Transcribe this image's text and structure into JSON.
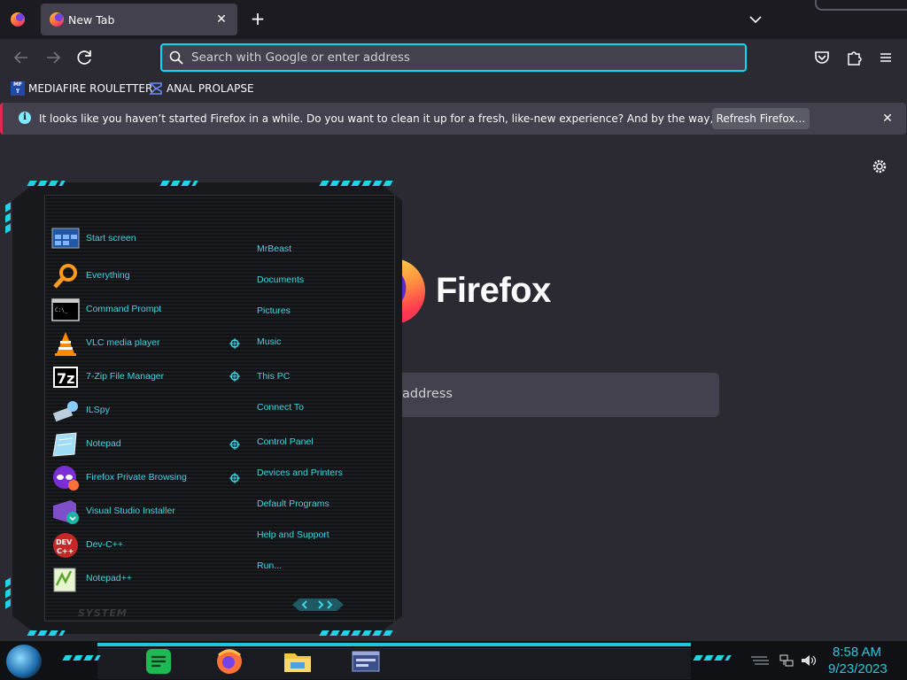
{
  "colors": {
    "accent": "#00ddff",
    "menu_text": "#3fd6e4",
    "clock": "#2ec6de",
    "notice_border": "#e22850"
  },
  "tabs": [
    {
      "title": "New Tab",
      "icon": "firefox-icon",
      "close_label": "✕"
    }
  ],
  "tabstrip": {
    "new_tab_label": "+"
  },
  "urlbar": {
    "placeholder": "Search with Google or enter address"
  },
  "bookmarks": [
    {
      "label": "MEDIAFIRE ROULETTER",
      "icon": "mediafire-icon",
      "icon_text": "MF T"
    },
    {
      "label": "ANAL PROLAPSE",
      "icon": "sigma-icon"
    }
  ],
  "notice": {
    "text": "It looks like you haven’t started Firefox in a while. Do you want to clean it up for a fresh, like-new experience? And by the way, welcome back!",
    "button": "Refresh Firefox…",
    "info_glyph": "i",
    "close_glyph": "✕"
  },
  "newtab": {
    "brand": "Firefox",
    "search_placeholder_visible": "address"
  },
  "startmenu": {
    "left_items": [
      {
        "label": "Start screen",
        "icon": "start-screen-icon"
      },
      {
        "label": "Everything",
        "icon": "magnifier-icon"
      },
      {
        "label": "Command Prompt",
        "icon": "command-prompt-icon"
      },
      {
        "label": "VLC media player",
        "icon": "vlc-cone-icon"
      },
      {
        "label": "7-Zip File Manager",
        "icon": "7zip-icon"
      },
      {
        "label": "ILSpy",
        "icon": "ilspy-icon"
      },
      {
        "label": "Notepad",
        "icon": "notepad-icon"
      },
      {
        "label": "Firefox Private Browsing",
        "icon": "private-browsing-icon"
      },
      {
        "label": "Visual Studio Installer",
        "icon": "visual-studio-installer-icon"
      },
      {
        "label": "Dev-C++",
        "icon": "devcpp-icon"
      },
      {
        "label": "Notepad++",
        "icon": "notepadpp-icon"
      }
    ],
    "right_items": [
      {
        "label": "MrBeast"
      },
      {
        "label": "Documents"
      },
      {
        "label": "Pictures"
      },
      {
        "label": "Music"
      },
      {
        "label": "This PC"
      },
      {
        "label": "Connect To"
      },
      {
        "label": "Control Panel"
      },
      {
        "label": "Devices and Printers"
      },
      {
        "label": "Default Programs"
      },
      {
        "label": "Help and Support"
      },
      {
        "label": "Run..."
      }
    ],
    "system_label": "SYSTEM",
    "pager": "‹ › ›"
  },
  "taskbar": {
    "pinned": [
      {
        "name": "notes",
        "icon": "notes-icon"
      },
      {
        "name": "firefox",
        "icon": "firefox-icon"
      },
      {
        "name": "file-explorer",
        "icon": "folder-icon"
      },
      {
        "name": "window",
        "icon": "window-icon"
      }
    ],
    "clock": {
      "time": "8:58 AM",
      "date": "9/23/2023"
    }
  }
}
